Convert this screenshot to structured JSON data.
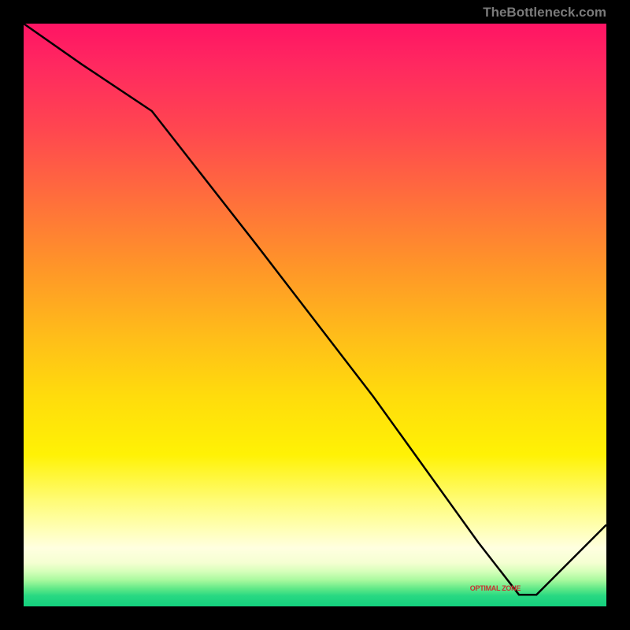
{
  "watermark": "TheBottleneck.com",
  "chart_data": {
    "type": "line",
    "title": "",
    "xlabel": "",
    "ylabel": "",
    "x_range": [
      0,
      100
    ],
    "y_range": [
      0,
      100
    ],
    "series": [
      {
        "name": "bottleneck-curve",
        "x": [
          0,
          10,
          22,
          40,
          60,
          78,
          85,
          88,
          100
        ],
        "y": [
          100,
          93,
          85,
          62,
          36,
          11,
          2,
          2,
          14
        ]
      }
    ],
    "markers": [
      {
        "name": "optimal-label",
        "x": 82,
        "y": 3,
        "text": "OPTIMAL ZONE"
      }
    ],
    "background_gradient": {
      "top": "#ff1464",
      "mid_upper": "#ff9628",
      "mid": "#fff205",
      "band": "#ffffe0",
      "bottom": "#14d07e"
    }
  }
}
